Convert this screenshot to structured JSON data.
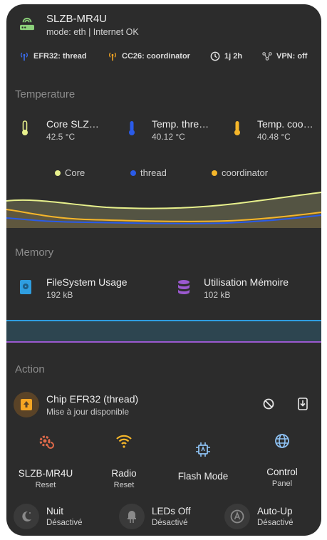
{
  "device": {
    "title": "SLZB-MR4U",
    "subtitle": "mode: eth | Internet OK"
  },
  "badges": [
    {
      "label": "EFR32: thread",
      "color": "#3b6ff5",
      "icon": "antenna-icon"
    },
    {
      "label": "CC26: coordinator",
      "color": "#f5a623",
      "icon": "antenna-icon"
    },
    {
      "label": "1j 2h",
      "color": "#e6e6e6",
      "icon": "clock-icon"
    },
    {
      "label": "VPN: off",
      "color": "#bdbdbd",
      "icon": "vpn-icon"
    }
  ],
  "temperature": {
    "section_title": "Temperature",
    "sensors": [
      {
        "name": "Core SLZ…",
        "value": "42.5 °C",
        "color": "#e7f08c"
      },
      {
        "name": "Temp. thre…",
        "value": "40.12 °C",
        "color": "#2a5be8"
      },
      {
        "name": "Temp. coo…",
        "value": "40.48 °C",
        "color": "#f5b62a"
      }
    ],
    "legend": [
      {
        "label": "Core",
        "color": "#e7f08c"
      },
      {
        "label": "thread",
        "color": "#2a5be8"
      },
      {
        "label": "coordinator",
        "color": "#f5b62a"
      }
    ]
  },
  "memory": {
    "section_title": "Memory",
    "items": [
      {
        "name": "FileSystem Usage",
        "value": "192 kB",
        "color": "#2f9ee0"
      },
      {
        "name": "Utilisation Mémoire",
        "value": "102 kB",
        "color": "#9b59d0"
      }
    ]
  },
  "action": {
    "section_title": "Action",
    "chip": {
      "name": "Chip EFR32 (thread)",
      "status": "Mise à jour disponible"
    },
    "buttons": [
      {
        "label": "SLZB-MR4U",
        "sub": "Reset",
        "color": "#e06a4a"
      },
      {
        "label": "Radio",
        "sub": "Reset",
        "color": "#f5b62a"
      },
      {
        "label": "Flash Mode",
        "sub": "",
        "color": "#8fc3f5"
      },
      {
        "label": "Control",
        "sub": "Panel",
        "color": "#8fc3f5"
      }
    ],
    "toggles": [
      {
        "name": "Nuit",
        "state": "Désactivé"
      },
      {
        "name": "LEDs Off",
        "state": "Désactivé"
      },
      {
        "name": "Auto-Up",
        "state": "Désactivé"
      }
    ]
  }
}
